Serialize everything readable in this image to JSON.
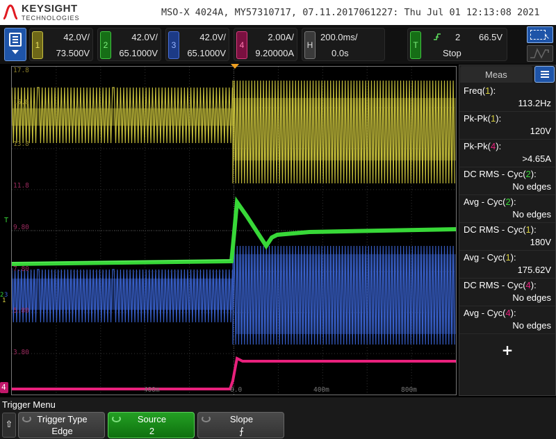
{
  "header": {
    "brand": "KEYSIGHT",
    "brand_sub": "TECHNOLOGIES",
    "instrument_info": "MSO-X 4024A, MY57310717, 07.11.2017061227: Thu Jul 01 12:13:08 2021"
  },
  "channels": [
    {
      "id": "1",
      "scale": "42.0V/",
      "offset": "73.500V",
      "color": "#d8d040"
    },
    {
      "id": "2",
      "scale": "42.0V/",
      "offset": "65.1000V",
      "color": "#38d838"
    },
    {
      "id": "3",
      "scale": "42.0V/",
      "offset": "65.1000V",
      "color": "#3c66d8"
    },
    {
      "id": "4",
      "scale": "2.00A/",
      "offset": "9.20000A",
      "color": "#e8207c"
    }
  ],
  "horizontal": {
    "tag": "H",
    "scale": "200.0ms/",
    "delay": "0.0s"
  },
  "trigger": {
    "tag": "T",
    "slope_icon": "rising-edge-icon",
    "source": "2",
    "level": "66.5V",
    "status": "Stop"
  },
  "grid_labels": {
    "levels": [
      {
        "text": "17.8",
        "color": "#8a7e2a"
      },
      {
        "text": "15.8",
        "color": "#8a7e2a"
      },
      {
        "text": "13.8",
        "color": "#8a7e2a"
      },
      {
        "text": "11.8",
        "color": "#9b2a5e"
      },
      {
        "text": "9.80",
        "color": "#9b2a5e"
      },
      {
        "text": "7.80",
        "color": "#9b2a5e"
      },
      {
        "text": "5.80",
        "color": "#9b2a5e"
      },
      {
        "text": "3.80",
        "color": "#9b2a5e"
      }
    ],
    "time": [
      "-400m",
      "0.0",
      "400m",
      "800m"
    ]
  },
  "markers": {
    "trig_level": "T",
    "ch2": "2",
    "ch3": "3",
    "ch1": "1",
    "ch4": "4"
  },
  "meas": {
    "title": "Meas",
    "items": [
      {
        "name": "Freq(",
        "ch": "1",
        "close": "):",
        "ch_color": "#d8d040",
        "value": "113.2Hz"
      },
      {
        "name": "Pk-Pk(",
        "ch": "1",
        "close": "):",
        "ch_color": "#d8d040",
        "value": "120V"
      },
      {
        "name": "Pk-Pk(",
        "ch": "4",
        "close": "):",
        "ch_color": "#e8207c",
        "value": ">4.65A"
      },
      {
        "name": "DC RMS - Cyc(",
        "ch": "2",
        "close": "):",
        "ch_color": "#38d838",
        "value": "No edges"
      },
      {
        "name": "Avg - Cyc(",
        "ch": "2",
        "close": "):",
        "ch_color": "#38d838",
        "value": "No edges"
      },
      {
        "name": "DC RMS - Cyc(",
        "ch": "1",
        "close": "):",
        "ch_color": "#d8d040",
        "value": "180V"
      },
      {
        "name": "Avg - Cyc(",
        "ch": "1",
        "close": "):",
        "ch_color": "#d8d040",
        "value": "175.62V"
      },
      {
        "name": "DC RMS - Cyc(",
        "ch": "4",
        "close": "):",
        "ch_color": "#e8207c",
        "value": "No edges"
      },
      {
        "name": "Avg - Cyc(",
        "ch": "4",
        "close": "):",
        "ch_color": "#e8207c",
        "value": "No edges"
      }
    ],
    "add_label": "+"
  },
  "softkeys": {
    "menu_title": "Trigger Menu",
    "back_glyph": "⇧",
    "keys": [
      {
        "label": "Trigger Type",
        "value": "Edge"
      },
      {
        "label": "Source",
        "value": "2"
      },
      {
        "label": "Slope",
        "value": "⨍"
      }
    ]
  }
}
